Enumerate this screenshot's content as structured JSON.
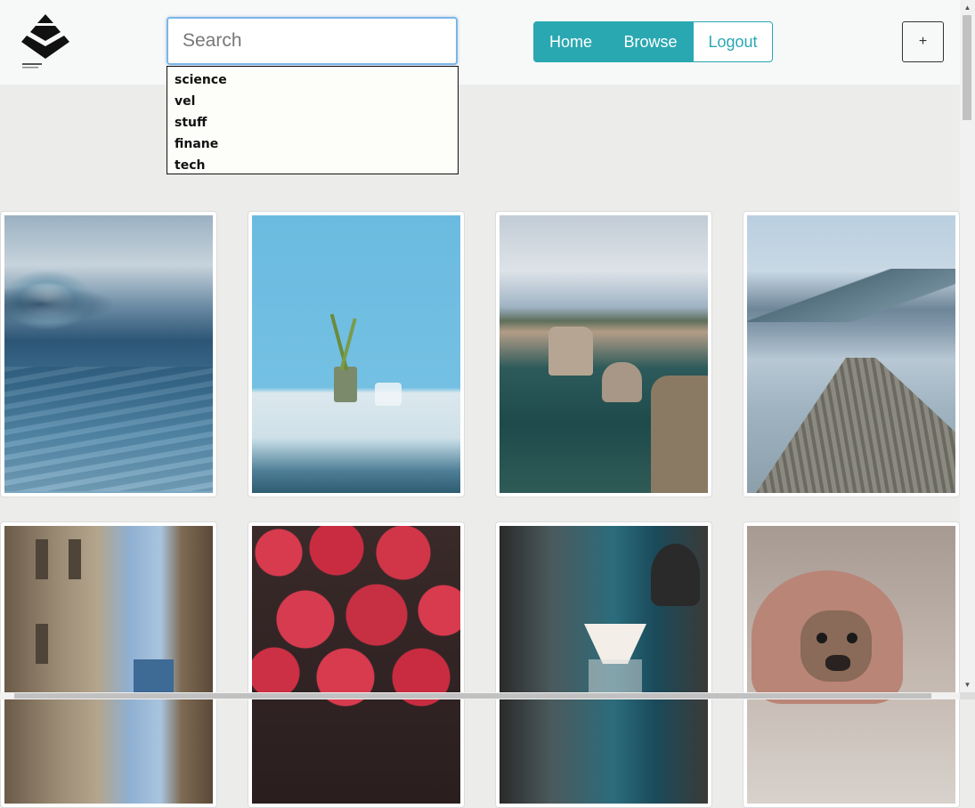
{
  "header": {
    "search": {
      "placeholder": "Search",
      "value": ""
    },
    "suggestions": [
      "science",
      "vel",
      "stuff",
      "finane",
      "tech"
    ],
    "nav": {
      "home": "Home",
      "browse": "Browse",
      "logout": "Logout"
    },
    "add_label": "+"
  },
  "gallery": [
    {
      "name": "photo-ocean-wave"
    },
    {
      "name": "photo-plant-jar"
    },
    {
      "name": "photo-coastal-cliffs"
    },
    {
      "name": "photo-wooden-pier-lake"
    },
    {
      "name": "photo-alley-buildings"
    },
    {
      "name": "photo-strawberries"
    },
    {
      "name": "photo-pour-over-coffee"
    },
    {
      "name": "photo-pug-blanket"
    }
  ],
  "colors": {
    "accent": "#2aa8b1",
    "page_bg": "#ececea",
    "header_bg": "#f7f8f8"
  }
}
